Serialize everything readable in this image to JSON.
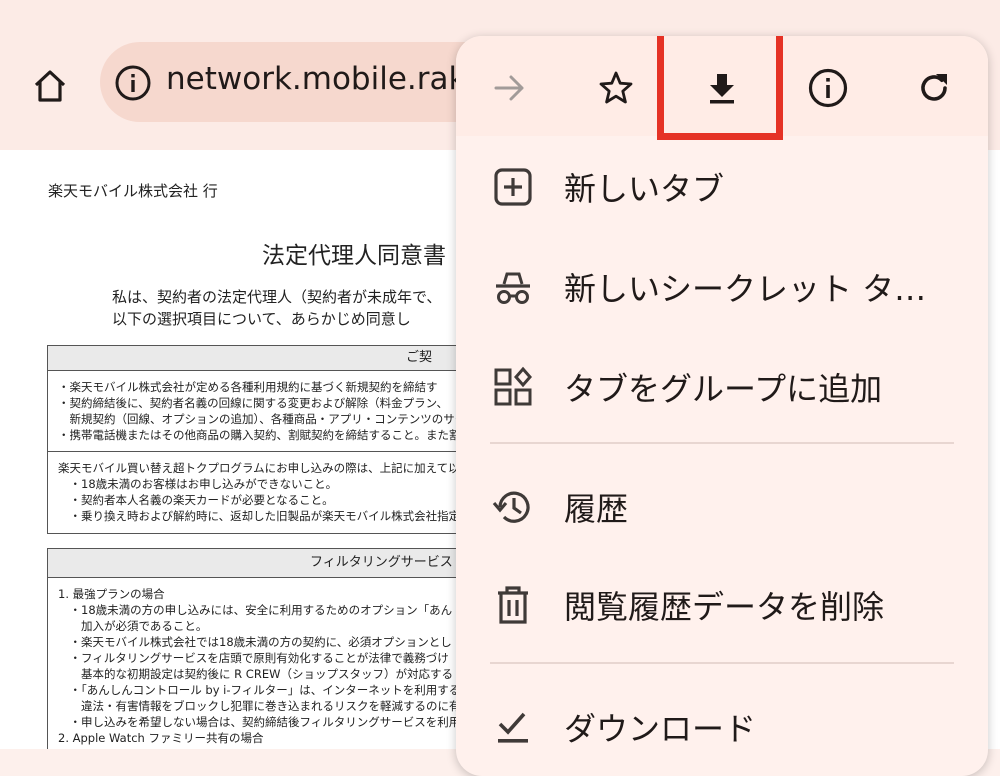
{
  "toolbar": {
    "url": "network.mobile.raku"
  },
  "document": {
    "company": "楽天モバイル株式会社 行",
    "title": "法定代理人同意書",
    "intro": [
      "私は、契約者の法定代理人（契約者が未成年で、",
      "以下の選択項目について、あらかじめ同意し"
    ],
    "box1": {
      "header": "ご契",
      "lines": [
        "・楽天モバイル株式会社が定める各種利用規約に基づく新規契約を締結す",
        "・契約締結後に、契約者名義の回線に関する変更および解除（料金プラン、",
        "　新規契約（回線、オプションの追加）、各種商品・アプリ・コンテンツのサービ",
        "・携帯電話機またはその他商品の購入契約、割賦契約を締結すること。また割"
      ],
      "lines2": [
        "楽天モバイル買い替え超トクプログラムにお申し込みの際は、上記に加えて以",
        "　・18歳未満のお客様はお申し込みができないこと。",
        "　・契約者本人名義の楽天カードが必要となること。",
        "　・乗り換え時および解約時に、返却した旧製品が楽天モバイル株式会社指定"
      ]
    },
    "box2": {
      "header": "フィルタリングサービス",
      "lines": [
        "1. 最強プランの場合",
        "　・18歳未満の方の申し込みには、安全に利用するためのオプション「あん",
        "　　加入が必須であること。",
        "　・楽天モバイル株式会社では18歳未満の方の契約に、必須オプションとし",
        "　・フィルタリングサービスを店頭で原則有効化することが法律で義務づけ",
        "　　基本的な初期設定は契約後に R CREW（ショップスタッフ）が対応する",
        "　・「あんしんコントロール by i-フィルター」は、インターネットを利用する際",
        "　　違法・有害情報をブロックし犯罪に巻き込まれるリスクを軽減するのに有",
        "　・申し込みを希望しない場合は、契約締結後フィルタリングサービスを利用",
        "2. Apple Watch ファミリー共有の場合"
      ]
    }
  },
  "menu": {
    "items": [
      {
        "label": "新しいタブ",
        "icon": "new-tab-icon"
      },
      {
        "label": "新しいシークレット タ…",
        "icon": "incognito-icon"
      },
      {
        "label": "タブをグループに追加",
        "icon": "tab-group-icon"
      },
      {
        "label": "履歴",
        "icon": "history-icon"
      },
      {
        "label": "閲覧履歴データを削除",
        "icon": "trash-icon"
      },
      {
        "label": "ダウンロード",
        "icon": "downloads-icon"
      }
    ]
  },
  "colors": {
    "highlight": "#e53225",
    "icon": "#3f3a38",
    "menu_bg": "#fff1ed"
  }
}
